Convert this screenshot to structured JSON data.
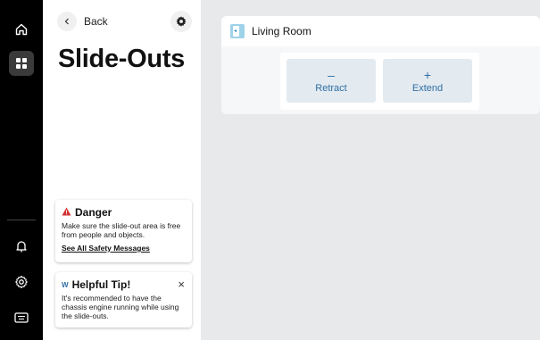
{
  "nav": {
    "items": [
      {
        "icon": "home-icon",
        "active": false
      },
      {
        "icon": "dashboard-grid-icon",
        "active": true
      }
    ],
    "bottom_items": [
      {
        "icon": "bell-icon"
      },
      {
        "icon": "settings-gear-icon"
      },
      {
        "icon": "keyboard-icon"
      }
    ]
  },
  "panel": {
    "back_label": "Back",
    "title": "Slide-Outs",
    "danger": {
      "title": "Danger",
      "body": "Make sure the slide-out area is free from people and objects.",
      "link": "See All Safety Messages",
      "color": "#d32f2f"
    },
    "tip": {
      "brand": "W",
      "title": "Helpful Tip!",
      "body": "It's recommended to have the chassis engine running while using the slide-outs.",
      "close": "×"
    }
  },
  "room": {
    "name": "Living Room",
    "retract": {
      "symbol": "–",
      "label": "Retract"
    },
    "extend": {
      "symbol": "+",
      "label": "Extend"
    },
    "accent": "#2f6fa3"
  }
}
